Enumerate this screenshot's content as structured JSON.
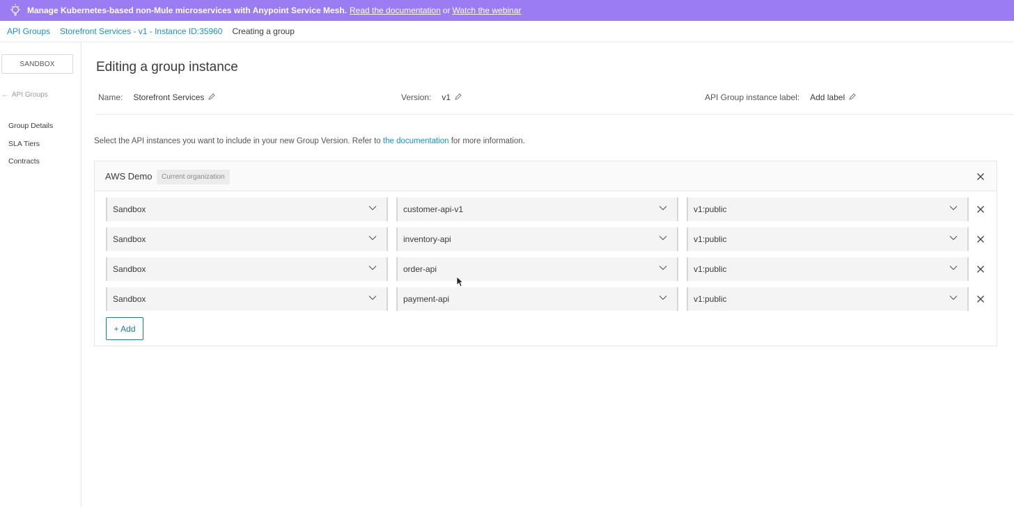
{
  "banner": {
    "message": "Manage Kubernetes-based non-Mule microservices with Anypoint Service Mesh.",
    "link1": "Read the documentation",
    "separator": "or",
    "link2": "Watch the webinar",
    "icon": "lightbulb-icon",
    "color": "#9b7cf2"
  },
  "breadcrumb": {
    "items": [
      "API Groups",
      "Storefront Services - v1 - Instance ID:35960"
    ],
    "current": "Creating a group"
  },
  "sidebar": {
    "environment": "SANDBOX",
    "back_link": "API Groups",
    "nav": [
      "Group Details",
      "SLA Tiers",
      "Contracts"
    ]
  },
  "page": {
    "title": "Editing a group instance",
    "name_label": "Name:",
    "name_value": "Storefront Services",
    "version_label": "Version:",
    "version_value": "v1",
    "instance_label_label": "API Group instance label:",
    "instance_label_value": "Add label",
    "instructions_before": "Select the API instances you want to include in your new Group Version. Refer to",
    "instructions_link": "the documentation",
    "instructions_after": "for more information."
  },
  "org": {
    "name": "AWS Demo",
    "badge": "Current organization",
    "rows": [
      {
        "environment": "Sandbox",
        "api": "customer-api-v1",
        "version": "v1:public"
      },
      {
        "environment": "Sandbox",
        "api": "inventory-api",
        "version": "v1:public"
      },
      {
        "environment": "Sandbox",
        "api": "order-api",
        "version": "v1:public"
      },
      {
        "environment": "Sandbox",
        "api": "payment-api",
        "version": "v1:public"
      }
    ],
    "add_label": "+ Add"
  },
  "colors": {
    "link": "#1d8ec7",
    "accent_button": "#1b7a8c"
  }
}
